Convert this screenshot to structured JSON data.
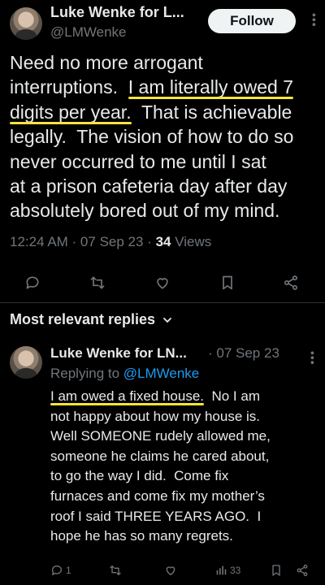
{
  "tweet": {
    "author_name": "Luke Wenke for L...",
    "handle": "@LMWenke",
    "follow_label": "Follow",
    "lines": [
      {
        "before": "Need no more arrogant",
        "highlight": "",
        "after": ""
      },
      {
        "before": "interruptions.  ",
        "highlight": "I am literally owed 7",
        "after": ""
      },
      {
        "before": "",
        "highlight": "digits per year.",
        "after": "  That is achievable"
      },
      {
        "before": "legally.  The vision of how to do so",
        "highlight": "",
        "after": ""
      },
      {
        "before": "never occurred to me until I sat",
        "highlight": "",
        "after": ""
      },
      {
        "before": "at a prison cafeteria day after day",
        "highlight": "",
        "after": ""
      },
      {
        "before": "absolutely bored out of my mind.",
        "highlight": "",
        "after": ""
      }
    ],
    "time": "12:24 AM · 07 Sep 23 · ",
    "views_count": "34",
    "views_label": " Views",
    "actions": [
      "reply-icon",
      "retweet-icon",
      "like-icon",
      "bookmark-icon",
      "share-icon"
    ]
  },
  "replies_section": {
    "title": "Most relevant replies",
    "chevron": "chevron-down-icon"
  },
  "reply": {
    "author_name": "Luke Wenke for LN...",
    "date": "· 07 Sep 23",
    "replying_prefix": "Replying to ",
    "replying_handle": "@LMWenke",
    "lines": [
      {
        "before": "",
        "highlight": "I am owed a fixed house.",
        "after": "  No I am"
      },
      {
        "before": "not happy about how my house is.",
        "highlight": "",
        "after": ""
      },
      {
        "before": "Well SOMEONE rudely allowed me,",
        "highlight": "",
        "after": ""
      },
      {
        "before": "someone he claims he cared about,",
        "highlight": "",
        "after": ""
      },
      {
        "before": "to go the way I did.  Come fix",
        "highlight": "",
        "after": ""
      },
      {
        "before": "furnaces and come fix my mother’s",
        "highlight": "",
        "after": ""
      },
      {
        "before": "roof I said THREE YEARS AGO.  I",
        "highlight": "",
        "after": ""
      },
      {
        "before": "hope he has so many regrets.",
        "highlight": "",
        "after": ""
      }
    ],
    "reply_count": "1",
    "views_count": "33"
  },
  "colors": {
    "background": "#000000",
    "text": "#e7e9ea",
    "muted": "#71767b",
    "link": "#1d9bf0",
    "highlight_underline": "#f5e53a"
  }
}
